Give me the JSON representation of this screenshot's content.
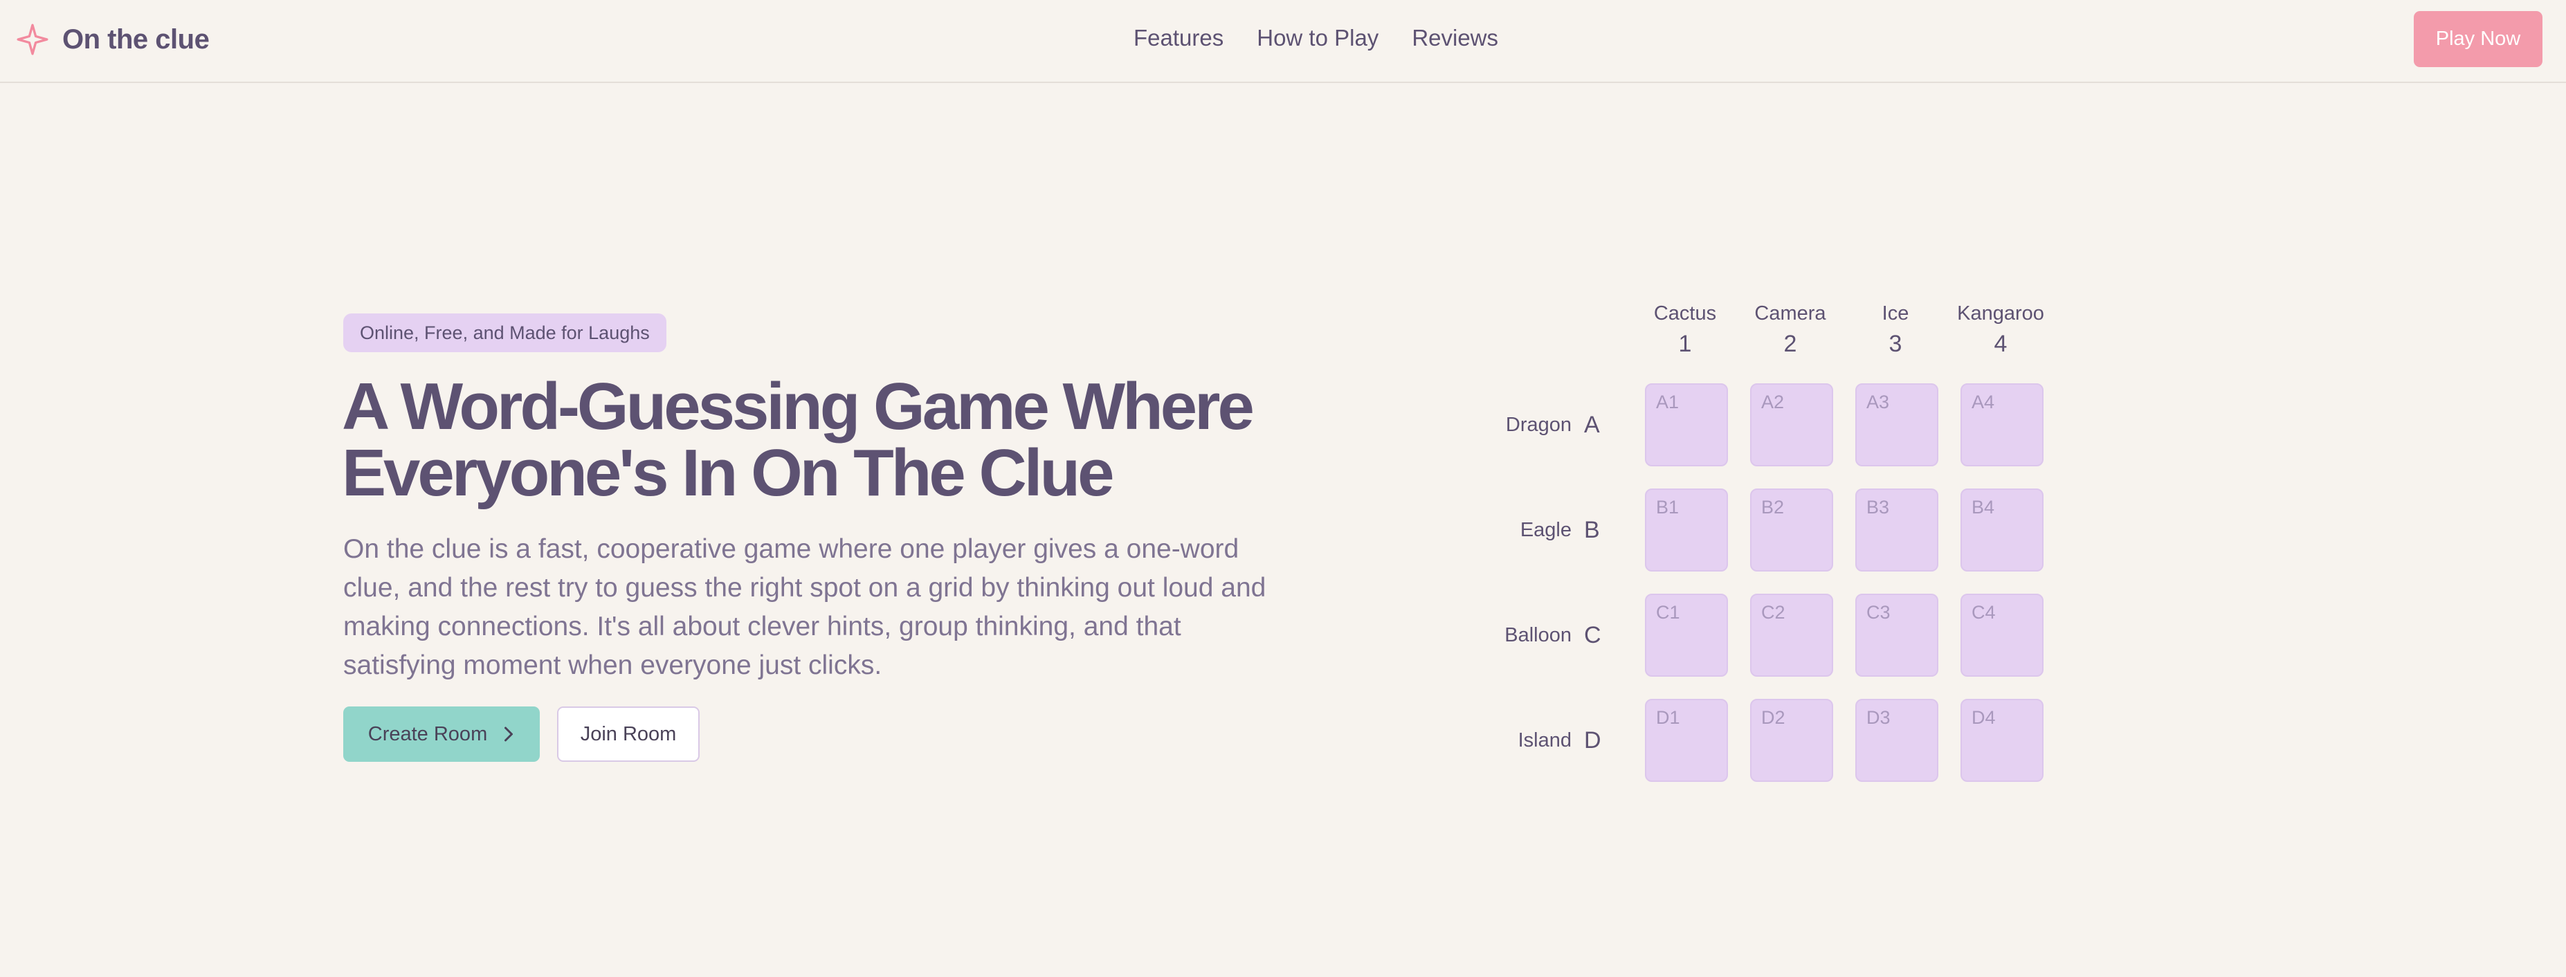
{
  "header": {
    "logo_text": "On the clue",
    "nav": [
      "Features",
      "How to Play",
      "Reviews"
    ],
    "play_label": "Play Now"
  },
  "colors": {
    "background": "#f7f3ee",
    "text": "#5d5272",
    "accent_pink": "#f39bab",
    "accent_teal": "#91d5ca",
    "tile_lavender": "#e5d1f2"
  },
  "hero": {
    "badge": "Online, Free, and Made for Laughs",
    "title_line1": "A Word-Guessing Game Where",
    "title_line2": "Everyone's In On The Clue",
    "description": "On the clue is a fast, cooperative game where one player gives a one-word clue, and the rest try to guess the right spot on a grid by thinking out loud and making connections. It's all about clever hints, group thinking, and that satisfying moment when everyone just clicks.",
    "create_label": "Create Room",
    "join_label": "Join Room"
  },
  "grid": {
    "columns": [
      {
        "word": "Cactus",
        "num": "1"
      },
      {
        "word": "Camera",
        "num": "2"
      },
      {
        "word": "Ice",
        "num": "3"
      },
      {
        "word": "Kangaroo",
        "num": "4"
      }
    ],
    "rows": [
      {
        "word": "Dragon",
        "letter": "A",
        "cells": [
          "A1",
          "A2",
          "A3",
          "A4"
        ]
      },
      {
        "word": "Eagle",
        "letter": "B",
        "cells": [
          "B1",
          "B2",
          "B3",
          "B4"
        ]
      },
      {
        "word": "Balloon",
        "letter": "C",
        "cells": [
          "C1",
          "C2",
          "C3",
          "C4"
        ]
      },
      {
        "word": "Island",
        "letter": "D",
        "cells": [
          "D1",
          "D2",
          "D3",
          "D4"
        ]
      }
    ]
  }
}
